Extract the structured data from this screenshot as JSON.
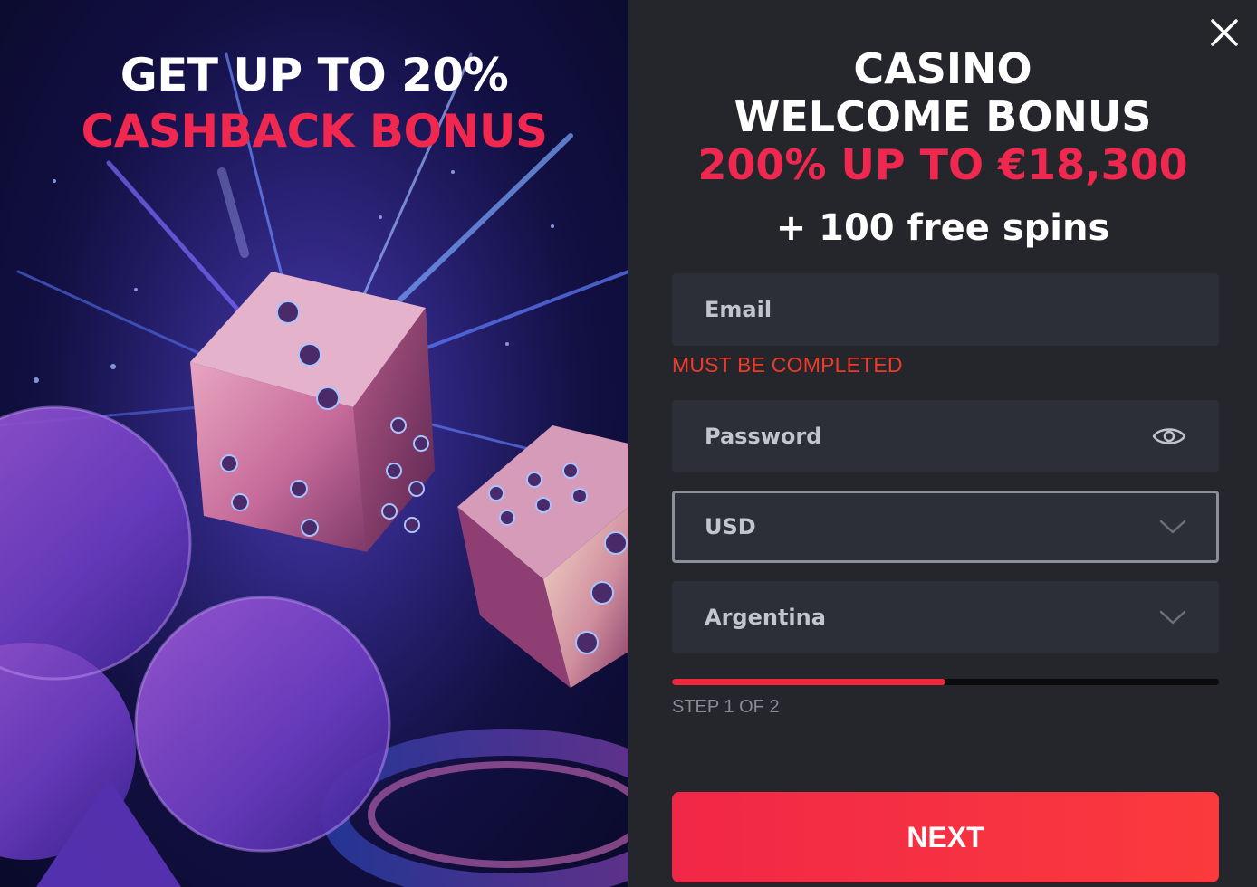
{
  "promo": {
    "line1": "GET UP TO 20%",
    "line2": "CASHBACK BONUS"
  },
  "headline": {
    "line1": "CASINO",
    "line2": "WELCOME BONUS",
    "offer": "200% UP TO €18,300",
    "spins": "+ 100 free spins"
  },
  "form": {
    "email": {
      "placeholder": "Email",
      "value": ""
    },
    "email_error": "MUST BE COMPLETED",
    "password": {
      "placeholder": "Password",
      "value": ""
    },
    "currency": {
      "selected": "USD"
    },
    "country": {
      "selected": "Argentina"
    },
    "progress": {
      "fraction": 0.5
    },
    "step_text": "STEP 1 OF 2",
    "next_label": "NEXT"
  },
  "icons": {
    "close": "close-icon",
    "password_toggle": "eye-icon",
    "currency_dropdown": "chevron-down-icon",
    "country_dropdown": "chevron-down-icon"
  },
  "colors": {
    "accent_red": "#f0284f",
    "error": "#ee3a28",
    "panel_bg": "#25262b",
    "field_bg": "#2d2f38"
  }
}
